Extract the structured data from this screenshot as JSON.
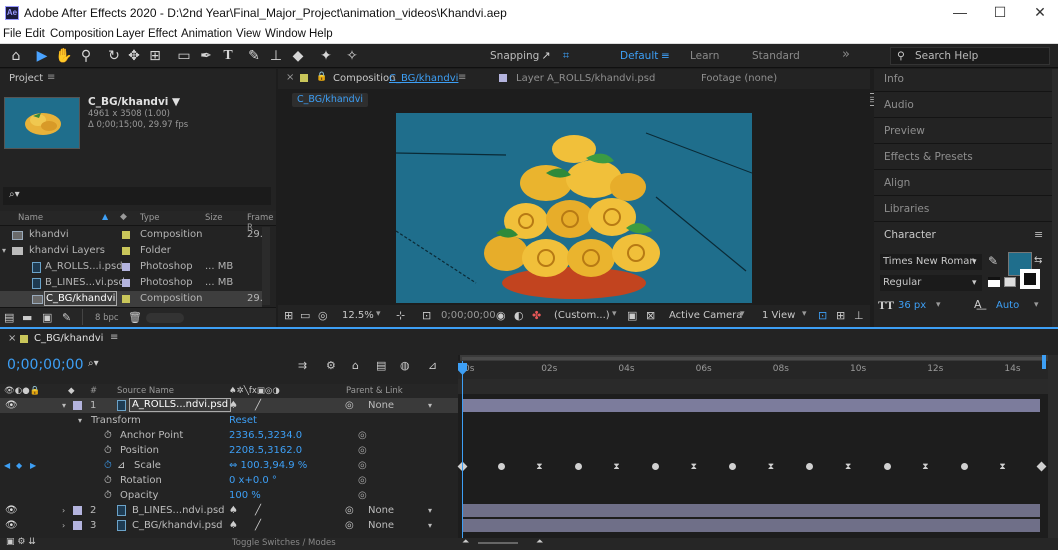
{
  "window": {
    "title": "Adobe After Effects 2020 - D:\\2nd Year\\Final_Major_Project\\animation_videos\\Khandvi.aep",
    "app_icon": "Ae",
    "min": "—",
    "max": "☐",
    "close": "✕"
  },
  "menu": [
    "File",
    "Edit",
    "Composition",
    "Layer",
    "Effect",
    "Animation",
    "View",
    "Window",
    "Help"
  ],
  "toolbar": {
    "snapping": "Snapping",
    "workspaces": [
      "Default",
      "Learn",
      "Standard"
    ],
    "more": "»",
    "search_placeholder": "Search Help"
  },
  "project": {
    "title": "Project",
    "selected_name": "C_BG/khandvi ▼",
    "selected_dims": "4961 x 3508 (1.00)",
    "selected_duration": "Δ 0;00;15;00, 29.97 fps",
    "search_icon": "⌕▾",
    "columns": {
      "name": "Name",
      "type": "Type",
      "size": "Size",
      "frame_rate": "Frame R"
    },
    "items": [
      {
        "name": "khandvi",
        "type": "Composition",
        "size": "",
        "fr": "29.",
        "color": "#c9c65a"
      },
      {
        "name": "khandvi Layers",
        "type": "Folder",
        "size": "",
        "fr": "",
        "color": "#c9c65a"
      },
      {
        "name": "A_ROLLS...i.psd",
        "type": "Photoshop",
        "size": "... MB",
        "fr": "",
        "color": "#b4b4de"
      },
      {
        "name": "B_LINES...vi.psd",
        "type": "Photoshop",
        "size": "... MB",
        "fr": "",
        "color": "#b4b4de"
      },
      {
        "name": "C_BG/khandvi",
        "type": "Composition",
        "size": "",
        "fr": "29.",
        "color": "#c9c65a"
      }
    ],
    "bpc": "8 bpc"
  },
  "comp_tabs": {
    "composition": "Composition",
    "composition_name": "C_BG/khandvi",
    "layer": "Layer A_ROLLS/khandvi.psd",
    "footage": "Footage (none)",
    "breadcrumb": "C_BG/khandvi"
  },
  "viewer_bar": {
    "zoom": "12.5%",
    "timecode": "0;00;00;00",
    "resolution": "(Custom...)",
    "camera": "Active Camera",
    "views": "1 View"
  },
  "right_panel": {
    "items": [
      "Info",
      "Audio",
      "Preview",
      "Effects & Presets",
      "Align",
      "Libraries"
    ],
    "character": {
      "title": "Character",
      "font": "Times New Roman",
      "style": "Regular",
      "size": "36 px",
      "tracking": "Auto",
      "swatch": "#1f6e8c"
    }
  },
  "timeline": {
    "tab": "C_BG/khandvi",
    "timecode": "0;00;00;00",
    "search_icon": "⌕▾",
    "col_source": "Source Name",
    "col_parent": "Parent & Link",
    "switches": "♠✲╲fx▣◎◑",
    "ruler": [
      "0s",
      "02s",
      "04s",
      "06s",
      "08s",
      "10s",
      "12s",
      "14s"
    ],
    "layers": [
      {
        "num": "1",
        "name": "A_ROLLS...ndvi.psd",
        "parent": "None",
        "selected": true
      },
      {
        "num": "2",
        "name": "B_LINES...ndvi.psd",
        "parent": "None",
        "selected": false
      },
      {
        "num": "3",
        "name": "C_BG/khandvi.psd",
        "parent": "None",
        "selected": false
      }
    ],
    "transform": {
      "label": "Transform",
      "reset": "Reset",
      "props": [
        {
          "name": "Anchor Point",
          "value": "2336.5,3234.0"
        },
        {
          "name": "Position",
          "value": "2208.5,3162.0"
        },
        {
          "name": "Scale",
          "value": "⇔ 100.3,94.9 %"
        },
        {
          "name": "Rotation",
          "value": "0 x+0.0 °"
        },
        {
          "name": "Opacity",
          "value": "100 %"
        }
      ]
    },
    "toggle_label": "Toggle Switches / Modes",
    "keyframe_times_s": [
      0,
      1,
      2,
      3,
      4,
      5,
      6,
      7,
      8,
      9,
      10,
      11,
      12,
      13,
      14,
      15
    ]
  },
  "colors": {
    "accent": "#3d9ff5",
    "bg": "#1d1d1d",
    "panel": "#232323",
    "comp_bg": "#1f6e8c",
    "bar": "#6f6f88"
  }
}
